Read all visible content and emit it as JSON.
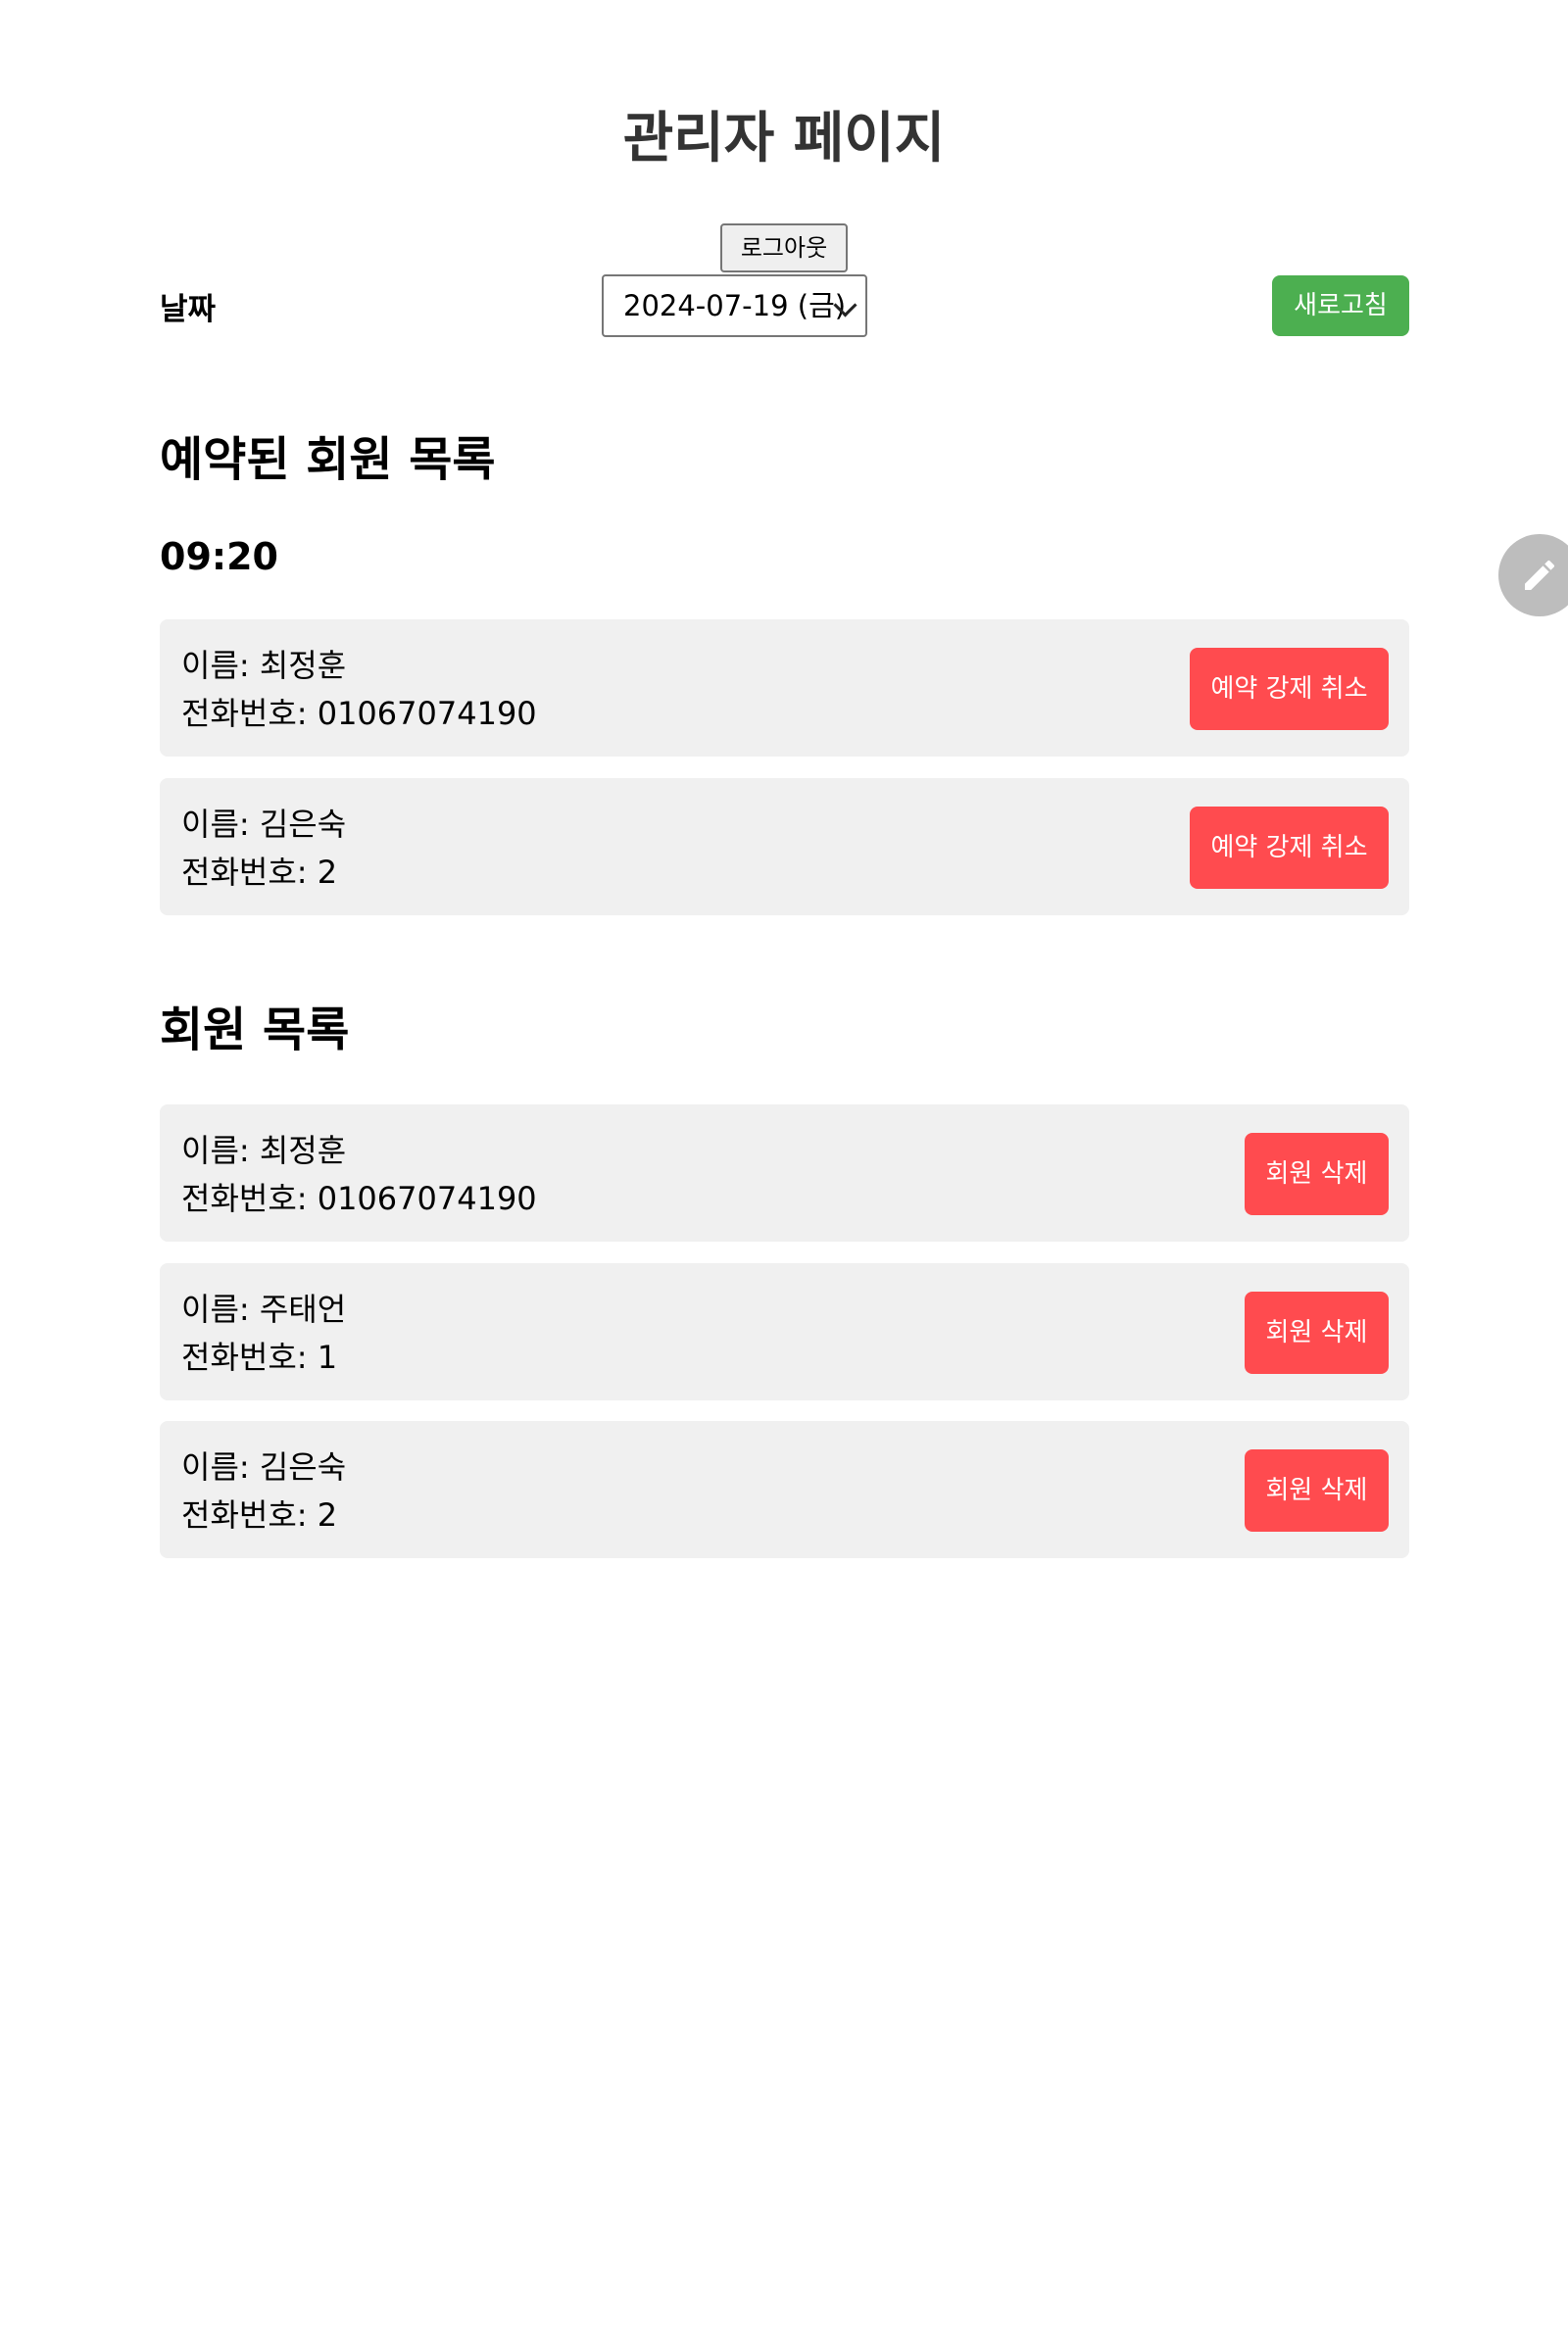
{
  "header": {
    "title": "관리자 페이지",
    "logout_label": "로그아웃"
  },
  "date_picker": {
    "label": "날짜",
    "selected": "2024-07-19 (금)",
    "refresh_label": "새로고침"
  },
  "reserved": {
    "heading": "예약된 회원 목록",
    "time": "09:20",
    "items": [
      {
        "name": "이름: 최정훈",
        "phone": "전화번호: 01067074190",
        "action": "예약 강제 취소"
      },
      {
        "name": "이름: 김은숙",
        "phone": "전화번호: 2",
        "action": "예약 강제 취소"
      }
    ]
  },
  "members": {
    "heading": "회원 목록",
    "items": [
      {
        "name": "이름: 최정훈",
        "phone": "전화번호: 01067074190",
        "action": "회원 삭제"
      },
      {
        "name": "이름: 주태언",
        "phone": "전화번호: 1",
        "action": "회원 삭제"
      },
      {
        "name": "이름: 김은숙",
        "phone": "전화번호: 2",
        "action": "회원 삭제"
      }
    ]
  },
  "colors": {
    "refresh": "#4caf50",
    "danger": "#ff4b4f",
    "card_bg": "#f0f0f0",
    "fab": "#bdbdbd"
  },
  "icons": {
    "fab": "pencil-icon",
    "select": "chevron-down-icon"
  }
}
